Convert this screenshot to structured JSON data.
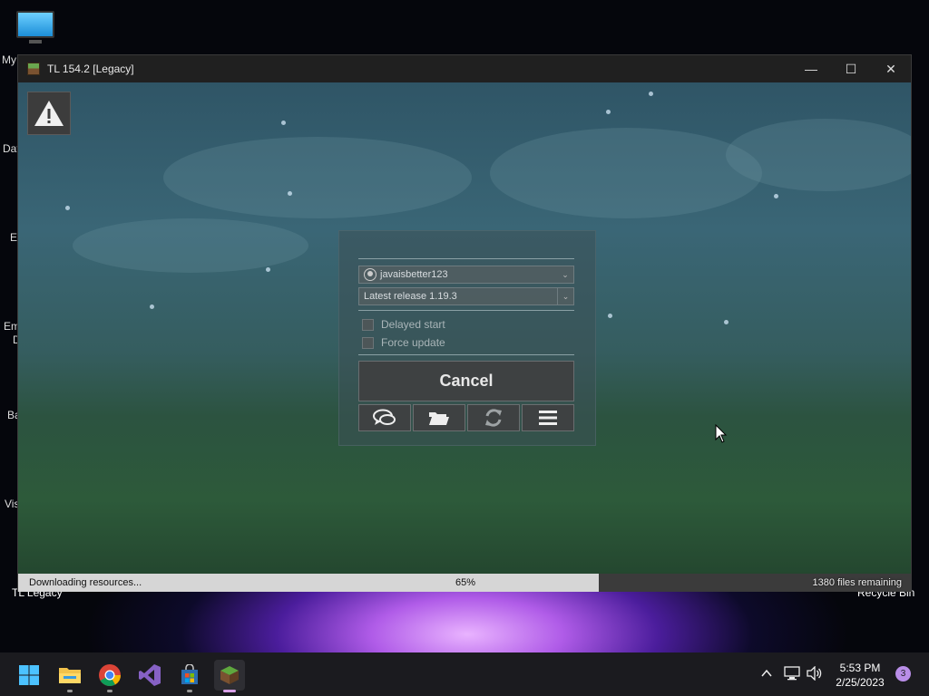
{
  "desktop": {
    "icon_labels_partial": [
      "My",
      "Dat",
      "Ev",
      "Em",
      "D",
      "Ba",
      "Vis"
    ],
    "tl_legacy_label": "TL Legacy",
    "recycle_bin_label": "Recycle Bin"
  },
  "window": {
    "title": "TL 154.2 [Legacy]",
    "controls": {
      "minimize": "—",
      "maximize": "☐",
      "close": "✕"
    }
  },
  "launcher": {
    "warning_icon": "warning-triangle-icon",
    "account": {
      "username": "javaisbetter123"
    },
    "version": {
      "selected": "Latest release 1.19.3"
    },
    "options": [
      {
        "label": "Delayed start",
        "checked": false
      },
      {
        "label": "Force update",
        "checked": false
      }
    ],
    "cancel_label": "Cancel",
    "toolbar": [
      "chat-icon",
      "folder-icon",
      "refresh-icon",
      "menu-icon"
    ]
  },
  "status": {
    "text": "Downloading resources...",
    "percent_label": "65%",
    "progress": 0.65,
    "files_remaining": "1380 files remaining"
  },
  "taskbar": {
    "apps": [
      "windows-start-icon",
      "file-explorer-icon",
      "chrome-icon",
      "visual-studio-icon",
      "microsoft-store-icon",
      "tl-legacy-icon"
    ],
    "tray_icons": [
      "chevron-up-icon",
      "network-icon",
      "volume-icon"
    ],
    "time": "5:53 PM",
    "date": "2/25/2023",
    "notification_count": "3"
  }
}
